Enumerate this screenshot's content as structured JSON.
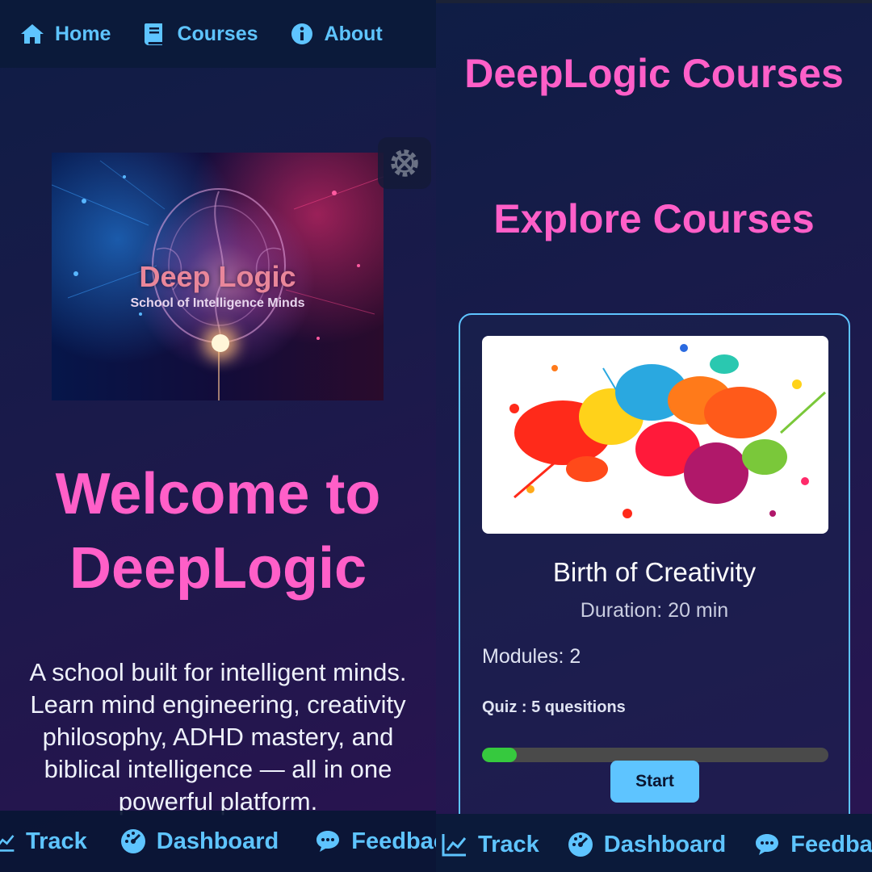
{
  "left_screen": {
    "nav": {
      "home_label": "Home",
      "courses_label": "Courses",
      "about_label": "About"
    },
    "hero": {
      "title": "Deep Logic",
      "subtitle": "School of Intelligence Minds"
    },
    "welcome_line1": "Welcome to",
    "welcome_line2": "DeepLogic",
    "intro_text": "A school built for intelligent minds. Learn mind engineering, creativity philosophy, ADHD mastery, and biblical intelligence — all in one powerful platform.",
    "bottom_nav": {
      "track_label": "Track",
      "dashboard_label": "Dashboard",
      "feedback_label": "Feedback"
    }
  },
  "right_screen": {
    "page_title": "DeepLogic Courses",
    "section_title": "Explore Courses",
    "course": {
      "title": "Birth of Creativity",
      "duration": "Duration: 20 min",
      "modules": "Modules: 2",
      "quiz": "Quiz : 5 quesitions",
      "progress_percent": 10,
      "start_label": "Start"
    },
    "bottom_nav": {
      "track_label": "Track",
      "dashboard_label": "Dashboard",
      "feedback_label": "Feedback"
    }
  },
  "colors": {
    "accent_blue": "#5ec4ff",
    "heading_pink": "#ff5fc8",
    "progress_green": "#36c93e",
    "nav_bg": "#0b1a3a"
  },
  "icons": [
    "home-icon",
    "book-icon",
    "info-icon",
    "settings-tools-icon",
    "chart-line-icon",
    "dashboard-gauge-icon",
    "comment-dots-icon"
  ]
}
